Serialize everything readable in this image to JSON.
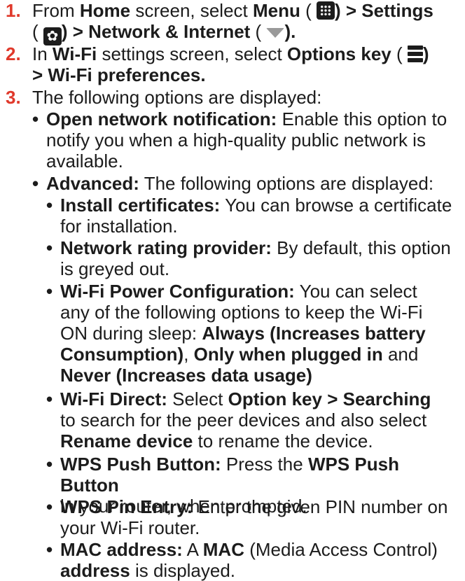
{
  "steps": [
    {
      "number": "1.",
      "parts": {
        "t1": "From ",
        "b1": "Home",
        "t2": " screen, select ",
        "b2": "Menu",
        "t3": " ( ",
        "b3": ") > Settings",
        "line2_a": "( ",
        "line2_b": ") > Network & Internet",
        "t4": " ( ",
        "b4": ")."
      }
    },
    {
      "number": "2.",
      "parts": {
        "t1": "In ",
        "b1": "Wi-Fi",
        "t2": " settings screen, select ",
        "b2": "Options key",
        "t3": " ( ",
        "b3": ")",
        "line2": "> Wi-Fi preferences."
      }
    },
    {
      "number": "3.",
      "text": "The following options are displayed:"
    }
  ],
  "options": [
    {
      "label": "Open network notification:",
      "lines": [
        "Enable this option to",
        "notify you when a high-quality public network is",
        "available."
      ]
    },
    {
      "label": "Advanced:",
      "text": "The following options are displayed:"
    }
  ],
  "advanced": [
    {
      "label": "Install certificates:",
      "l1": "You can browse a certificate",
      "l2": "for installation."
    },
    {
      "label": "Network rating provider:",
      "l1": "By default, this option",
      "l2": "is greyed out."
    },
    {
      "label": "Wi-Fi Power Configuration:",
      "l1": "You can select",
      "l2": "any of the following options to keep the Wi-Fi",
      "l3a": "ON during sleep: ",
      "l3b": "Always (Increases battery",
      "l4a": "Consumption)",
      "l4b": ", ",
      "l4c": "Only when plugged in",
      "l4d": " and",
      "l5": "Never (Increases data usage)"
    },
    {
      "label": "Wi-Fi Direct:",
      "t1": "Select ",
      "b1": "Option key > Searching",
      "l2": "to search for the peer devices and also select",
      "l3a": "Rename device",
      "l3b": " to rename the device."
    },
    {
      "label": "WPS Push Button:",
      "t1": "Press the ",
      "b1": "WPS Push Button",
      "l2": "in your router, when prompted."
    },
    {
      "label": "WPS Pin Entry:",
      "l1": "Enter the given PIN number on",
      "l2": "your Wi-Fi router."
    },
    {
      "label": "MAC address:",
      "t1": "A ",
      "b1": "MAC",
      "t2": " (Media Access Control)",
      "l2a": "address",
      "l2b": " is displayed."
    }
  ],
  "icons": {
    "menu": "grid-icon",
    "settings": "gear-icon",
    "network": "wifi-icon",
    "options": "menu-lines-icon"
  }
}
